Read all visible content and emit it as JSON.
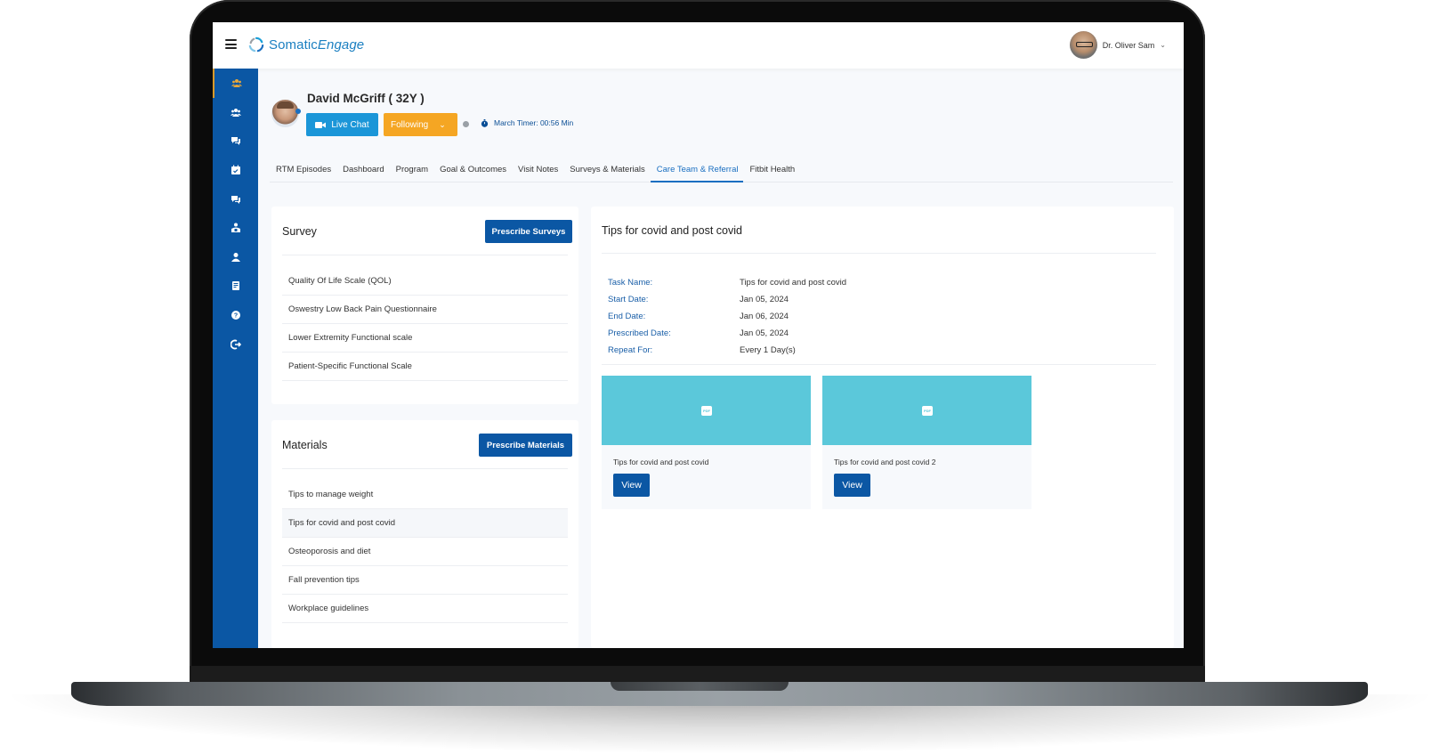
{
  "app": {
    "brand_primary": "Somatic",
    "brand_secondary": "Engage",
    "brand_color": "#1a7fc1",
    "sidebar_color": "#0b57a4",
    "accent_orange": "#f5a623",
    "accent_blue": "#1b96d8"
  },
  "header": {
    "menu_icon": "hamburger-icon",
    "user_name": "Dr. Oliver Sam",
    "user_caret_icon": "chevron-down-icon"
  },
  "sidebar": {
    "items": [
      {
        "icon": "patients-group-icon",
        "active": true
      },
      {
        "icon": "users-icon",
        "active": false
      },
      {
        "icon": "chat-bubbles-icon",
        "active": false
      },
      {
        "icon": "calendar-check-icon",
        "active": false
      },
      {
        "icon": "messages-icon",
        "active": false
      },
      {
        "icon": "care-team-icon",
        "active": false
      },
      {
        "icon": "user-icon",
        "active": false
      },
      {
        "icon": "document-icon",
        "active": false
      },
      {
        "icon": "help-icon",
        "active": false
      },
      {
        "icon": "logout-icon",
        "active": false
      }
    ]
  },
  "patient": {
    "name": "David McGriff ( 32Y )",
    "live_chat_label": "Live Chat",
    "following_label": "Following",
    "timer_label": "March Timer: 00:56 Min"
  },
  "tabs": [
    {
      "label": "RTM Episodes",
      "active": false
    },
    {
      "label": "Dashboard",
      "active": false
    },
    {
      "label": "Program",
      "active": false
    },
    {
      "label": "Goal & Outcomes",
      "active": false
    },
    {
      "label": "Visit Notes",
      "active": false
    },
    {
      "label": "Surveys & Materials",
      "active": false
    },
    {
      "label": "Care Team & Referral",
      "active": true
    },
    {
      "label": "Fitbit Health",
      "active": false
    }
  ],
  "survey": {
    "title": "Survey",
    "button_label": "Prescribe Surveys",
    "items": [
      "Quality Of Life Scale (QOL)",
      "Oswestry Low Back Pain Questionnaire",
      "Lower Extremity Functional scale",
      "Patient-Specific Functional Scale"
    ]
  },
  "materials": {
    "title": "Materials",
    "button_label": "Prescribe Materials",
    "selected_index": 1,
    "items": [
      "Tips to manage weight",
      "Tips for covid and post covid",
      "Osteoporosis and diet",
      "Fall prevention tips",
      "Workplace guidelines"
    ]
  },
  "detail": {
    "title": "Tips for covid and post covid",
    "fields": [
      {
        "label": "Task Name:",
        "value": "Tips for covid and post covid"
      },
      {
        "label": "Start Date:",
        "value": "Jan 05, 2024"
      },
      {
        "label": "End Date:",
        "value": "Jan 06, 2024"
      },
      {
        "label": "Prescribed Date:",
        "value": "Jan 05, 2024"
      },
      {
        "label": "Repeat For:",
        "value": "Every 1 Day(s)"
      }
    ],
    "files": [
      {
        "name": "Tips for covid and post covid",
        "type": "PDF",
        "button_label": "View"
      },
      {
        "name": "Tips for covid and post covid 2",
        "type": "PDF",
        "button_label": "View"
      }
    ],
    "thumb_color": "#5bc8da"
  }
}
